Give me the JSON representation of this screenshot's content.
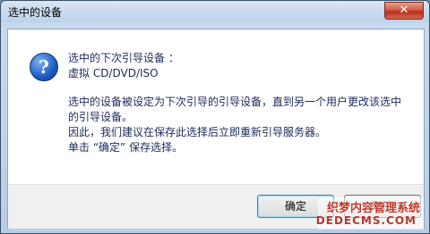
{
  "window": {
    "title": "选中的设备",
    "close_label": "✕"
  },
  "message": {
    "icon": "question-icon",
    "line1": "选中的下次引导设备 ：",
    "line2": "虚拟 CD/DVD/ISO",
    "body": [
      "选中的设备被设定为下次引导的引导设备，直到另一个用户更改该选中",
      "的引导设备。",
      "因此，我们建议在保存此选择后立即重新引导服务器。",
      "单击 “确定” 保存选择。"
    ]
  },
  "buttons": {
    "ok_label": "确定",
    "cancel_label": "取消"
  },
  "watermark": {
    "line1": "织梦内容管理系统",
    "line2": "DEDECMS.COM"
  }
}
